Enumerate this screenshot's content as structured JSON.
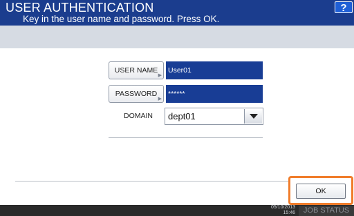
{
  "header": {
    "title": "USER AUTHENTICATION",
    "subtitle": "Key in the user name and password. Press OK.",
    "help_label": "?"
  },
  "form": {
    "username_button": "USER NAME",
    "username_value": "User01",
    "password_button": "PASSWORD",
    "password_value": "******",
    "domain_label": "DOMAIN",
    "domain_value": "dept01"
  },
  "actions": {
    "ok_label": "OK"
  },
  "status": {
    "date": "05/10/2013",
    "time": "15:46",
    "job_status_label": "JOB STATUS"
  },
  "colors": {
    "title_bar": "#1b3d8e",
    "field_value_bg": "#183d95",
    "ok_highlight": "#f07d2c"
  }
}
